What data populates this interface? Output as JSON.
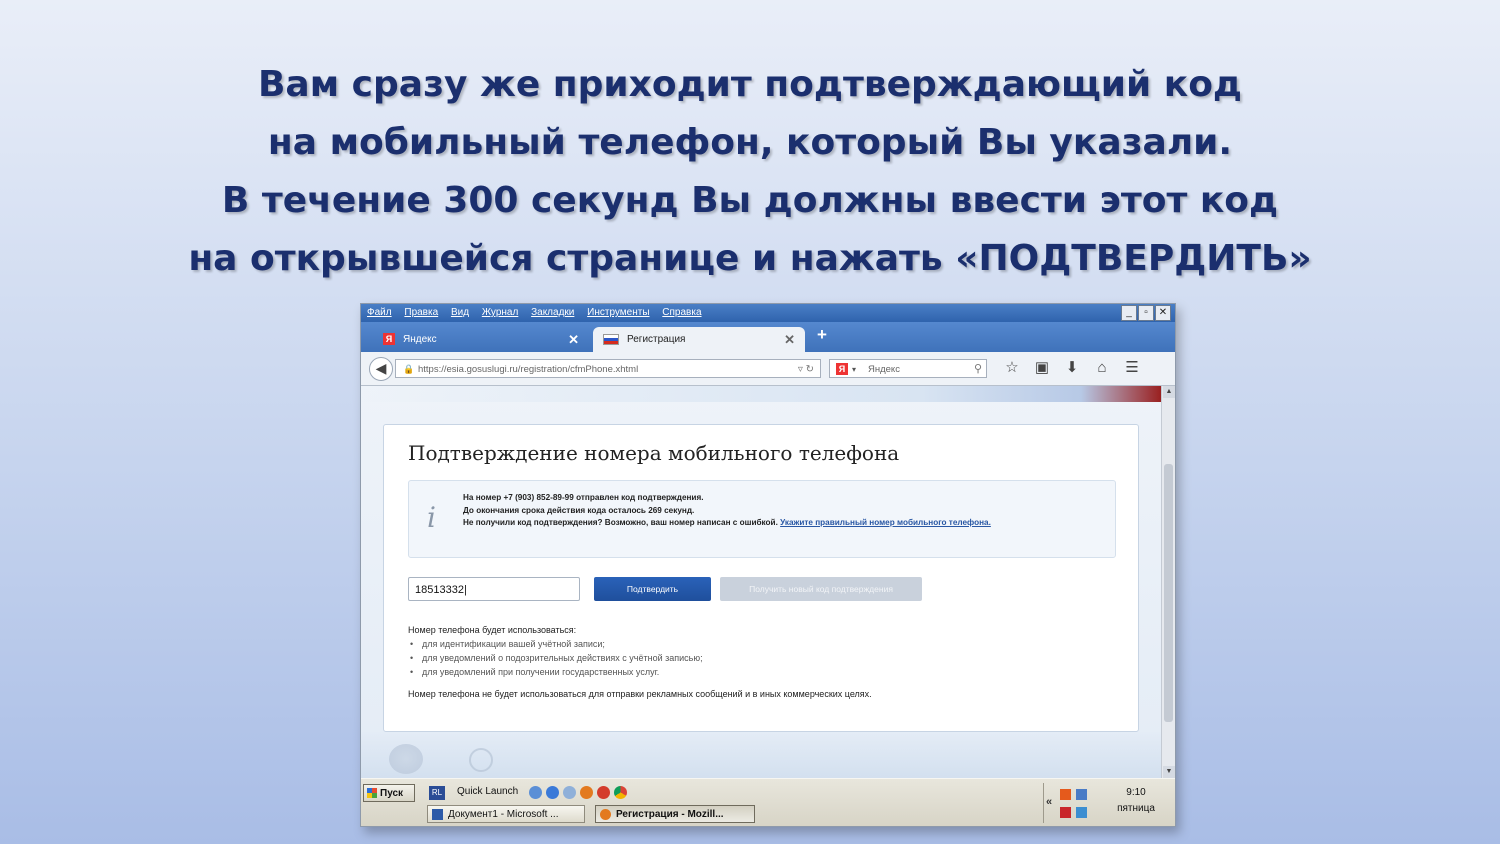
{
  "heading": {
    "lines": [
      "Вам сразу же приходит подтверждающий код",
      "на мобильный телефон, который Вы указали.",
      "В течение 300 секунд Вы должны ввести этот код",
      "на открывшейся странице и нажать «ПОДТВЕРДИТЬ»"
    ]
  },
  "browser": {
    "menu": [
      "Файл",
      "Правка",
      "Вид",
      "Журнал",
      "Закладки",
      "Инструменты",
      "Справка"
    ],
    "window_buttons": [
      "_",
      "▫",
      "✕"
    ],
    "tabs": [
      {
        "label": "Яндекс",
        "icon": "yandex-icon"
      },
      {
        "label": "Регистрация",
        "icon": "russia-flag-icon"
      }
    ],
    "new_tab": "+",
    "url": "https://esia.gosuslugi.ru/registration/cfmPhone.xhtml",
    "search_placeholder": "Яндекс",
    "toolbar_icons": [
      "star-icon",
      "clipboard-icon",
      "download-icon",
      "home-icon",
      "menu-icon"
    ]
  },
  "page": {
    "title": "Подтверждение номера мобильного телефона",
    "info": {
      "line1": "На номер +7 (903) 852-89-99 отправлен код подтверждения.",
      "line2": "До окончания срока действия кода осталось 269 секунд.",
      "line3_prefix": "Не получили код подтверждения? Возможно, ваш номер написан с ошибкой. ",
      "line3_link": "Укажите правильный номер мобильного телефона."
    },
    "code_value": "18513332",
    "confirm_label": "Подтвердить",
    "new_code_label": "Получить новый код подтверждения",
    "usage_title": "Номер телефона будет использоваться:",
    "usage_items": [
      "для идентификации вашей учётной записи;",
      "для уведомлений о подозрительных действиях с учётной записью;",
      "для уведомлений при получении государственных услуг."
    ],
    "usage_note": "Номер телефона не будет использоваться для отправки рекламных сообщений и в иных коммерческих целях."
  },
  "taskbar": {
    "start_label": "Пуск",
    "rl_label": "RL",
    "quick_launch": "Quick Launch",
    "tasks": [
      {
        "label": "Документ1 - Microsoft ...",
        "icon": "word-icon"
      },
      {
        "label": "Регистрация - Mozill...",
        "icon": "firefox-icon"
      }
    ],
    "tray_chevron": "«",
    "time": "9:10",
    "day": "пятница"
  }
}
